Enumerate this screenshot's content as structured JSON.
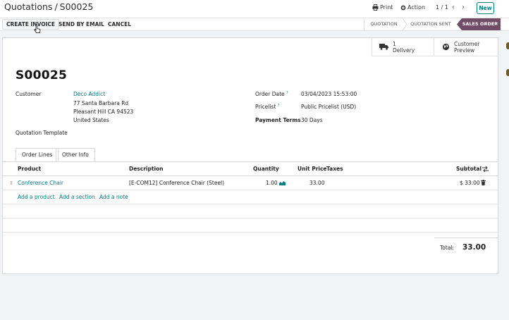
{
  "header": {
    "breadcrumb_parent": "Quotations",
    "breadcrumb_sep": "/",
    "record": "S00025",
    "print_label": "Print",
    "action_label": "Action",
    "pager": "1 / 1",
    "new_label": "New"
  },
  "control_panel": {
    "create_invoice": "CREATE INVOICE",
    "send_by_email": "SEND BY EMAIL",
    "cancel": "CANCEL",
    "statuses": [
      "QUOTATION",
      "QUOTATION SENT",
      "SALES ORDER"
    ],
    "active_status": "SALES ORDER"
  },
  "smart_buttons": {
    "delivery_count": "1",
    "delivery_label": "Delivery",
    "preview_line1": "Customer",
    "preview_line2": "Preview"
  },
  "form": {
    "name": "S00025",
    "customer_label": "Customer",
    "customer_name": "Deco Addict",
    "address_line1": "77 Santa Barbara Rd",
    "address_line2": "Pleasant Hill CA 94523",
    "address_line3": "United States",
    "template_label": "Quotation Template",
    "order_date_label": "Order Date",
    "order_date": "03/04/2023 15:53:00",
    "pricelist_label": "Pricelist",
    "pricelist": "Public Pricelist (USD)",
    "payment_terms_label": "Payment Terms",
    "payment_terms": "30 Days",
    "help_mark": "?"
  },
  "tabs": [
    "Order Lines",
    "Other Info"
  ],
  "lines": {
    "headers": [
      "Product",
      "Description",
      "Quantity",
      "Unit Price",
      "Taxes",
      "Subtotal"
    ],
    "rows": [
      {
        "product": "Conference Chair",
        "description": "[E-COM12] Conference Chair (Steel)",
        "quantity": "1.00",
        "unit_price": "33.00",
        "taxes": "",
        "subtotal": "$ 33.00"
      }
    ],
    "add_product": "Add a product",
    "add_section": "Add a section",
    "add_note": "Add a note"
  },
  "totals": {
    "label": "Total:",
    "value": "33.00"
  },
  "colors": {
    "accent": "#017e84",
    "status_active": "#714b67"
  }
}
